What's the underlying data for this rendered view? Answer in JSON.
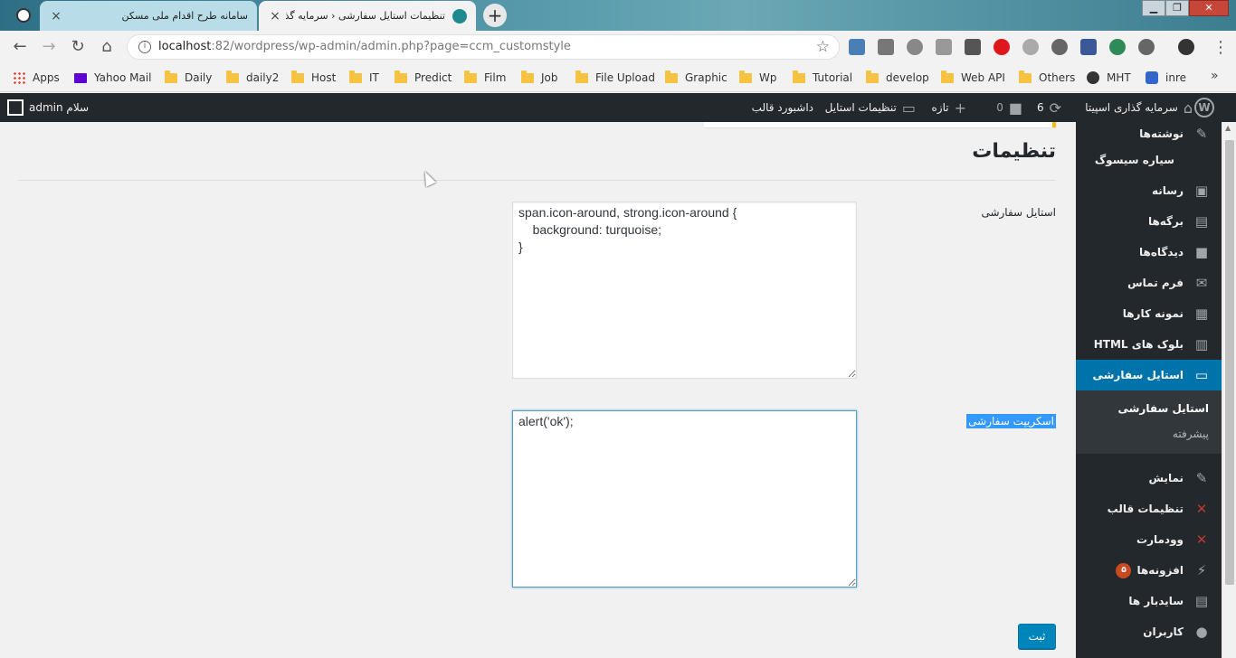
{
  "browser": {
    "tabs": [
      {
        "title": "سامانه طرح اقدام ملی مسکن",
        "close": "×"
      },
      {
        "title": "تنظیمات استایل سفارشی ‹ سرمایه گذاری ا",
        "close": "×"
      }
    ],
    "new_tab": "+",
    "window": {
      "minimize": "▁",
      "maximize": "❐",
      "close": "✕"
    },
    "url_host": "localhost",
    "url_rest": ":82/wordpress/wp-admin/admin.php?page=ccm_customstyle",
    "bookmarks": [
      "Apps",
      "Yahoo Mail",
      "Daily",
      "daily2",
      "Host",
      "IT",
      "Predict",
      "Film",
      "Job",
      "File Upload",
      "Graphic",
      "Wp",
      "Tutorial",
      "develop",
      "Web API",
      "Others",
      "MHT",
      "inre"
    ],
    "bookmarks_more": "»"
  },
  "adminbar": {
    "site_name": "سرمایه گذاری اسپیتا",
    "updates_count": "6",
    "comments_count": "0",
    "new_label": "تازه",
    "custom_style_label": "تنظیمات استایل",
    "theme_dashboard_label": "داشبورد قالب",
    "greeting": "سلام admin"
  },
  "menu": {
    "items_top": [
      {
        "label": "نوشته‌ها",
        "icon": "pin-icon"
      },
      {
        "label": "سیاره سیسوگ",
        "icon": ""
      },
      {
        "label": "رسانه",
        "icon": "media-icon"
      },
      {
        "label": "برگه‌ها",
        "icon": "page-icon"
      },
      {
        "label": "دیدگاه‌ها",
        "icon": "comment-icon"
      },
      {
        "label": "فرم تماس",
        "icon": "mail-icon"
      },
      {
        "label": "نمونه کارها",
        "icon": "portfolio-icon"
      },
      {
        "label": "بلوک های HTML",
        "icon": "blocks-icon"
      }
    ],
    "current": {
      "label": "استایل سفارشی",
      "icon": "monitor-icon"
    },
    "submenu": [
      {
        "label": "استایل سفارشی"
      },
      {
        "label": "پیشرفته"
      }
    ],
    "items_bottom": [
      {
        "label": "نمایش",
        "icon": "brush-icon"
      },
      {
        "label": "تنظیمات قالب",
        "icon": "x-icon"
      },
      {
        "label": "وودمارت",
        "icon": "x-icon"
      },
      {
        "label": "افزونه‌ها",
        "icon": "plugin-icon",
        "badge": "۵"
      },
      {
        "label": "سایدبار ها",
        "icon": "sidebar-icon"
      },
      {
        "label": "کاربران",
        "icon": "user-icon"
      }
    ]
  },
  "page": {
    "title": "تنظیمات",
    "style_label": "استایل سفارشی",
    "style_value": "span.icon-around, strong.icon-around {\n    background: turquoise;\n}",
    "script_label": "اسکریپت سفارشی",
    "script_value": "alert('ok');",
    "submit_label": "ثبت"
  }
}
